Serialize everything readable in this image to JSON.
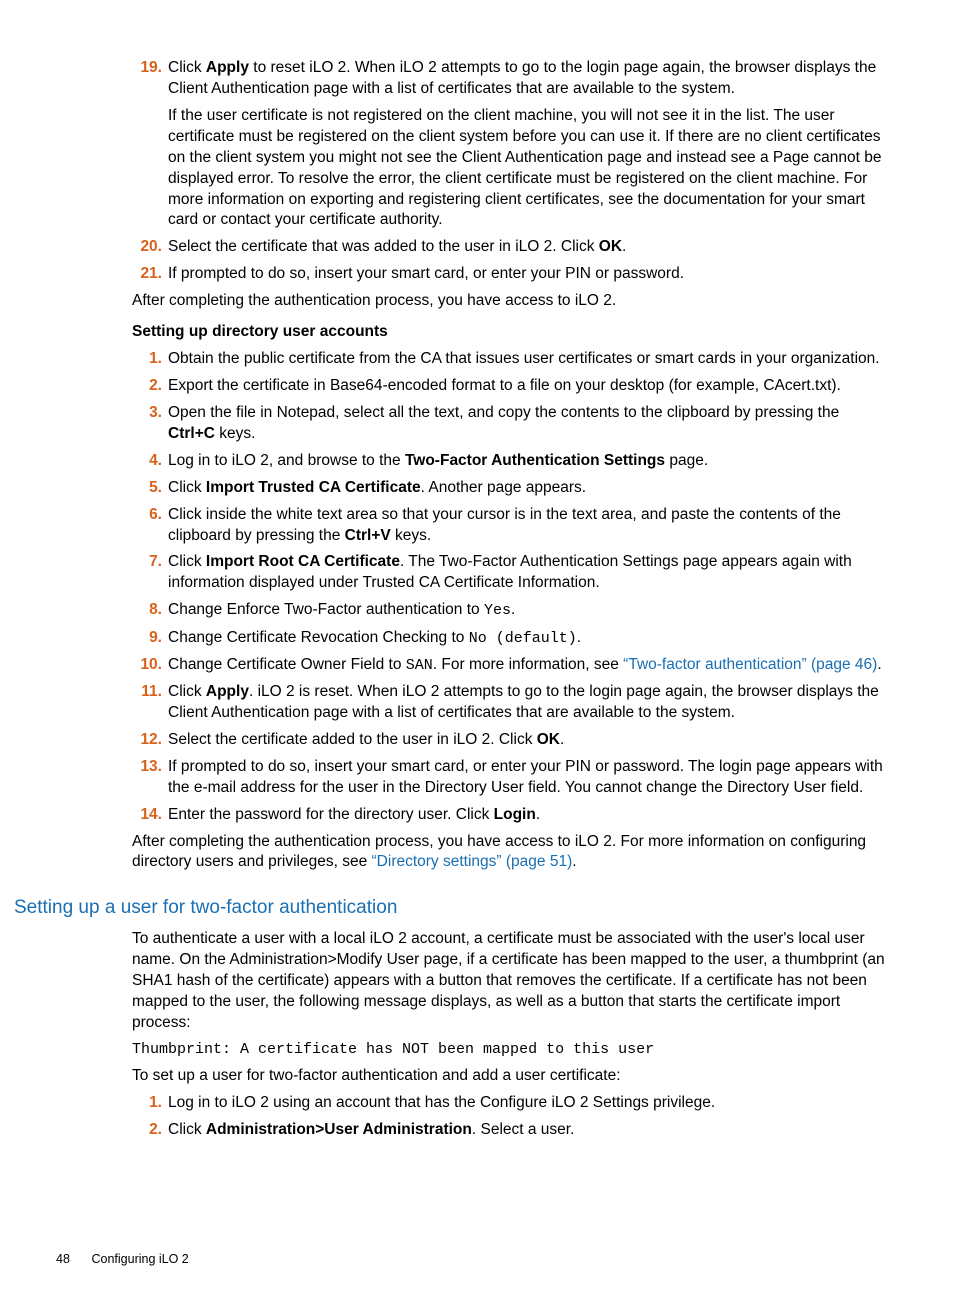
{
  "list1": {
    "items": [
      {
        "n": "19.",
        "html": "Click <b>Apply</b> to reset iLO 2. When iLO 2 attempts to go to the login page again, the browser displays the Client Authentication page with a list of certificates that are available to the system.",
        "extra": "If the user certificate is not registered on the client machine, you will not see it in the list. The user certificate must be registered on the client system before you can use it. If there are no client certificates on the client system you might not see the Client Authentication page and instead see a Page cannot be displayed error. To resolve the error, the client certificate must be registered on the client machine. For more information on exporting and registering client certificates, see the documentation for your smart card or contact your certificate authority."
      },
      {
        "n": "20.",
        "html": "Select the certificate that was added to the user in iLO 2. Click <b>OK</b>."
      },
      {
        "n": "21.",
        "html": "If prompted to do so, insert your smart card, or enter your PIN or password."
      }
    ],
    "tail": "After completing the authentication process, you have access to iLO 2."
  },
  "subhead1": "Setting up directory user accounts",
  "list2": {
    "items": [
      {
        "n": "1.",
        "html": "Obtain the public certificate from the CA that issues user certificates or smart cards in your organization."
      },
      {
        "n": "2.",
        "html": "Export the certificate in Base64-encoded format to a file on your desktop (for example, CAcert.txt)."
      },
      {
        "n": "3.",
        "html": "Open the file in Notepad, select all the text, and copy the contents to the clipboard by pressing the <b>Ctrl+C</b> keys."
      },
      {
        "n": "4.",
        "html": "Log in to iLO 2, and browse to the <b>Two-Factor Authentication Settings</b> page."
      },
      {
        "n": "5.",
        "html": "Click <b>Import Trusted CA Certificate</b>. Another page appears."
      },
      {
        "n": "6.",
        "html": "Click inside the white text area so that your cursor is in the text area, and paste the contents of the clipboard by pressing the <b>Ctrl+V</b> keys."
      },
      {
        "n": "7.",
        "html": "Click <b>Import Root CA Certificate</b>. The Two-Factor Authentication Settings page appears again with information displayed under Trusted CA Certificate Information."
      },
      {
        "n": "8.",
        "html": "Change Enforce Two-Factor authentication to <span class=\"mono\">Yes</span>."
      },
      {
        "n": "9.",
        "html": "Change Certificate Revocation Checking to <span class=\"mono\">No (default)</span>."
      },
      {
        "n": "10.",
        "html": "Change Certificate Owner Field to <span class=\"mono\">SAN</span>. For more information, see <span class=\"link\">“Two-factor authentication” (page 46)</span>."
      },
      {
        "n": "11.",
        "html": "Click <b>Apply</b>. iLO 2 is reset. When iLO 2 attempts to go to the login page again, the browser displays the Client Authentication page with a list of certificates that are available to the system."
      },
      {
        "n": "12.",
        "html": "Select the certificate added to the user in iLO 2. Click <b>OK</b>."
      },
      {
        "n": "13.",
        "html": "If prompted to do so, insert your smart card, or enter your PIN or password. The login page appears with the e-mail address for the user in the Directory User field. You cannot change the Directory User field."
      },
      {
        "n": "14.",
        "html": "Enter the password for the directory user. Click <b>Login</b>."
      }
    ],
    "tail_html": "After completing the authentication process, you have access to iLO 2. For more information on configuring directory users and privileges, see <span class=\"link\">“Directory settings” (page 51)</span>."
  },
  "section2": {
    "title": "Setting up a user for two-factor authentication",
    "para1": "To authenticate a user with a local iLO 2 account, a certificate must be associated with the user's local user name. On the Administration>Modify User page, if a certificate has been mapped to the user, a thumbprint (an SHA1 hash of the certificate) appears with a button that removes the certificate. If a certificate has not been mapped to the user, the following message displays, as well as a button that starts the certificate import process:",
    "code": "Thumbprint: A certificate has NOT been mapped to this user",
    "para2": "To set up a user for two-factor authentication and add a user certificate:",
    "list": [
      {
        "n": "1.",
        "html": "Log in to iLO 2 using an account that has the Configure iLO 2 Settings privilege."
      },
      {
        "n": "2.",
        "html": "Click <b>Administration>User Administration</b>. Select a user."
      }
    ]
  },
  "footer": {
    "page": "48",
    "title": "Configuring iLO 2"
  }
}
